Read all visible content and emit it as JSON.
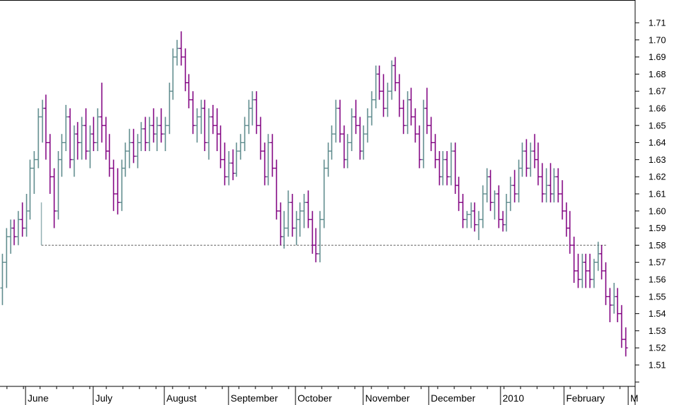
{
  "chart_data": {
    "type": "ohlc",
    "y_axis": {
      "position": "right",
      "ylim": [
        1.5,
        1.716
      ],
      "ticks": [
        "1.51",
        "1.52",
        "1.53",
        "1.54",
        "1.55",
        "1.56",
        "1.57",
        "1.58",
        "1.59",
        "1.60",
        "1.61",
        "1.62",
        "1.63",
        "1.64",
        "1.65",
        "1.66",
        "1.67",
        "1.68",
        "1.69",
        "1.70",
        "1.71"
      ]
    },
    "x_axis": {
      "months": [
        "June",
        "July",
        "August",
        "September",
        "October",
        "November",
        "December",
        "2010",
        "February",
        "M"
      ],
      "bars_per_month": [
        21,
        23,
        21,
        21,
        22,
        21,
        21,
        20,
        20,
        6
      ]
    },
    "colors": {
      "up": "#5d8a8c",
      "down": "#800080",
      "reference_line": "#666666"
    },
    "reference_line": {
      "y": 1.58,
      "style": "dotted",
      "from_month": "June",
      "to_month": "February"
    },
    "bars": [
      [
        1.555,
        1.575,
        1.545,
        1.57
      ],
      [
        1.57,
        1.59,
        1.555,
        1.585
      ],
      [
        1.585,
        1.595,
        1.575,
        1.59
      ],
      [
        1.59,
        1.595,
        1.58,
        1.585
      ],
      [
        1.585,
        1.6,
        1.58,
        1.595
      ],
      [
        1.595,
        1.605,
        1.585,
        1.59
      ],
      [
        1.59,
        1.61,
        1.585,
        1.6
      ],
      [
        1.6,
        1.63,
        1.595,
        1.625
      ],
      [
        1.625,
        1.635,
        1.61,
        1.63
      ],
      [
        1.63,
        1.66,
        1.625,
        1.655
      ],
      [
        1.655,
        1.665,
        1.64,
        1.66
      ],
      [
        1.66,
        1.668,
        1.63,
        1.64
      ],
      [
        1.64,
        1.645,
        1.61,
        1.62
      ],
      [
        1.62,
        1.625,
        1.59,
        1.6
      ],
      [
        1.6,
        1.635,
        1.595,
        1.63
      ],
      [
        1.63,
        1.645,
        1.62,
        1.64
      ],
      [
        1.64,
        1.662,
        1.635,
        1.655
      ],
      [
        1.655,
        1.66,
        1.625,
        1.63
      ],
      [
        1.63,
        1.65,
        1.62,
        1.645
      ],
      [
        1.645,
        1.652,
        1.63,
        1.64
      ],
      [
        1.64,
        1.655,
        1.63,
        1.65
      ],
      [
        1.65,
        1.66,
        1.63,
        1.635
      ],
      [
        1.635,
        1.65,
        1.625,
        1.645
      ],
      [
        1.645,
        1.655,
        1.635,
        1.64
      ],
      [
        1.64,
        1.66,
        1.635,
        1.655
      ],
      [
        1.655,
        1.675,
        1.64,
        1.65
      ],
      [
        1.65,
        1.655,
        1.63,
        1.635
      ],
      [
        1.635,
        1.645,
        1.62,
        1.625
      ],
      [
        1.625,
        1.63,
        1.6,
        1.61
      ],
      [
        1.61,
        1.625,
        1.598,
        1.605
      ],
      [
        1.605,
        1.63,
        1.6,
        1.625
      ],
      [
        1.625,
        1.64,
        1.62,
        1.635
      ],
      [
        1.635,
        1.648,
        1.625,
        1.64
      ],
      [
        1.64,
        1.648,
        1.628,
        1.632
      ],
      [
        1.632,
        1.645,
        1.625,
        1.64
      ],
      [
        1.64,
        1.652,
        1.635,
        1.648
      ],
      [
        1.648,
        1.655,
        1.635,
        1.64
      ],
      [
        1.64,
        1.655,
        1.635,
        1.65
      ],
      [
        1.65,
        1.66,
        1.64,
        1.645
      ],
      [
        1.645,
        1.655,
        1.635,
        1.65
      ],
      [
        1.65,
        1.66,
        1.64,
        1.645
      ],
      [
        1.645,
        1.655,
        1.635,
        1.65
      ],
      [
        1.65,
        1.675,
        1.645,
        1.67
      ],
      [
        1.67,
        1.695,
        1.665,
        1.69
      ],
      [
        1.69,
        1.7,
        1.685,
        1.695
      ],
      [
        1.695,
        1.705,
        1.685,
        1.69
      ],
      [
        1.69,
        1.695,
        1.67,
        1.675
      ],
      [
        1.675,
        1.68,
        1.66,
        1.665
      ],
      [
        1.665,
        1.67,
        1.645,
        1.65
      ],
      [
        1.65,
        1.66,
        1.64,
        1.655
      ],
      [
        1.655,
        1.665,
        1.645,
        1.66
      ],
      [
        1.66,
        1.665,
        1.635,
        1.64
      ],
      [
        1.64,
        1.66,
        1.63,
        1.655
      ],
      [
        1.655,
        1.662,
        1.645,
        1.65
      ],
      [
        1.65,
        1.66,
        1.635,
        1.645
      ],
      [
        1.645,
        1.65,
        1.625,
        1.63
      ],
      [
        1.63,
        1.64,
        1.615,
        1.62
      ],
      [
        1.62,
        1.635,
        1.615,
        1.628
      ],
      [
        1.628,
        1.636,
        1.618,
        1.622
      ],
      [
        1.622,
        1.64,
        1.62,
        1.635
      ],
      [
        1.635,
        1.645,
        1.63,
        1.64
      ],
      [
        1.64,
        1.655,
        1.635,
        1.65
      ],
      [
        1.65,
        1.665,
        1.645,
        1.66
      ],
      [
        1.66,
        1.67,
        1.65,
        1.665
      ],
      [
        1.665,
        1.67,
        1.645,
        1.65
      ],
      [
        1.65,
        1.655,
        1.63,
        1.635
      ],
      [
        1.635,
        1.64,
        1.615,
        1.62
      ],
      [
        1.62,
        1.645,
        1.615,
        1.64
      ],
      [
        1.64,
        1.645,
        1.62,
        1.625
      ],
      [
        1.625,
        1.63,
        1.595,
        1.6
      ],
      [
        1.6,
        1.605,
        1.58,
        1.585
      ],
      [
        1.585,
        1.6,
        1.578,
        1.59
      ],
      [
        1.59,
        1.612,
        1.585,
        1.605
      ],
      [
        1.605,
        1.61,
        1.585,
        1.59
      ],
      [
        1.59,
        1.6,
        1.58,
        1.595
      ],
      [
        1.595,
        1.605,
        1.585,
        1.6
      ],
      [
        1.6,
        1.61,
        1.59,
        1.605
      ],
      [
        1.605,
        1.612,
        1.59,
        1.595
      ],
      [
        1.595,
        1.6,
        1.575,
        1.58
      ],
      [
        1.58,
        1.59,
        1.57,
        1.575
      ],
      [
        1.575,
        1.6,
        1.57,
        1.595
      ],
      [
        1.595,
        1.63,
        1.59,
        1.625
      ],
      [
        1.625,
        1.64,
        1.62,
        1.635
      ],
      [
        1.635,
        1.65,
        1.63,
        1.645
      ],
      [
        1.645,
        1.665,
        1.64,
        1.66
      ],
      [
        1.66,
        1.665,
        1.64,
        1.645
      ],
      [
        1.645,
        1.65,
        1.625,
        1.63
      ],
      [
        1.63,
        1.645,
        1.625,
        1.64
      ],
      [
        1.64,
        1.66,
        1.635,
        1.655
      ],
      [
        1.655,
        1.665,
        1.645,
        1.65
      ],
      [
        1.65,
        1.655,
        1.63,
        1.635
      ],
      [
        1.635,
        1.65,
        1.63,
        1.645
      ],
      [
        1.645,
        1.66,
        1.64,
        1.655
      ],
      [
        1.655,
        1.67,
        1.65,
        1.665
      ],
      [
        1.665,
        1.685,
        1.66,
        1.68
      ],
      [
        1.68,
        1.685,
        1.665,
        1.67
      ],
      [
        1.67,
        1.68,
        1.655,
        1.66
      ],
      [
        1.66,
        1.675,
        1.655,
        1.67
      ],
      [
        1.67,
        1.688,
        1.665,
        1.685
      ],
      [
        1.685,
        1.69,
        1.67,
        1.675
      ],
      [
        1.675,
        1.68,
        1.655,
        1.66
      ],
      [
        1.66,
        1.665,
        1.645,
        1.65
      ],
      [
        1.65,
        1.67,
        1.645,
        1.665
      ],
      [
        1.665,
        1.672,
        1.65,
        1.655
      ],
      [
        1.655,
        1.66,
        1.64,
        1.645
      ],
      [
        1.645,
        1.65,
        1.625,
        1.63
      ],
      [
        1.63,
        1.665,
        1.625,
        1.66
      ],
      [
        1.66,
        1.672,
        1.645,
        1.65
      ],
      [
        1.65,
        1.655,
        1.635,
        1.64
      ],
      [
        1.64,
        1.645,
        1.625,
        1.63
      ],
      [
        1.63,
        1.635,
        1.615,
        1.62
      ],
      [
        1.62,
        1.635,
        1.615,
        1.63
      ],
      [
        1.63,
        1.635,
        1.615,
        1.62
      ],
      [
        1.62,
        1.64,
        1.615,
        1.635
      ],
      [
        1.635,
        1.64,
        1.61,
        1.615
      ],
      [
        1.615,
        1.62,
        1.6,
        1.605
      ],
      [
        1.605,
        1.61,
        1.59,
        1.595
      ],
      [
        1.595,
        1.6,
        1.59,
        1.598
      ],
      [
        1.598,
        1.605,
        1.59,
        1.6
      ],
      [
        1.6,
        1.605,
        1.588,
        1.592
      ],
      [
        1.592,
        1.6,
        1.583,
        1.595
      ],
      [
        1.595,
        1.615,
        1.59,
        1.61
      ],
      [
        1.61,
        1.625,
        1.605,
        1.62
      ],
      [
        1.62,
        1.624,
        1.6,
        1.605
      ],
      [
        1.605,
        1.612,
        1.595,
        1.61
      ],
      [
        1.61,
        1.615,
        1.59,
        1.595
      ],
      [
        1.595,
        1.6,
        1.588,
        1.592
      ],
      [
        1.592,
        1.61,
        1.588,
        1.605
      ],
      [
        1.605,
        1.62,
        1.6,
        1.615
      ],
      [
        1.615,
        1.624,
        1.605,
        1.61
      ],
      [
        1.61,
        1.63,
        1.605,
        1.625
      ],
      [
        1.625,
        1.64,
        1.62,
        1.635
      ],
      [
        1.635,
        1.642,
        1.62,
        1.625
      ],
      [
        1.625,
        1.64,
        1.62,
        1.635
      ],
      [
        1.635,
        1.645,
        1.625,
        1.63
      ],
      [
        1.63,
        1.64,
        1.615,
        1.62
      ],
      [
        1.62,
        1.628,
        1.605,
        1.61
      ],
      [
        1.61,
        1.625,
        1.605,
        1.615
      ],
      [
        1.615,
        1.628,
        1.605,
        1.61
      ],
      [
        1.61,
        1.625,
        1.605,
        1.62
      ],
      [
        1.62,
        1.625,
        1.605,
        1.61
      ],
      [
        1.61,
        1.618,
        1.595,
        1.6
      ],
      [
        1.6,
        1.605,
        1.585,
        1.59
      ],
      [
        1.59,
        1.6,
        1.575,
        1.58
      ],
      [
        1.58,
        1.585,
        1.558,
        1.565
      ],
      [
        1.565,
        1.575,
        1.555,
        1.56
      ],
      [
        1.56,
        1.575,
        1.555,
        1.57
      ],
      [
        1.57,
        1.575,
        1.555,
        1.565
      ],
      [
        1.565,
        1.575,
        1.555,
        1.56
      ],
      [
        1.56,
        1.572,
        1.555,
        1.57
      ],
      [
        1.57,
        1.582,
        1.565,
        1.575
      ],
      [
        1.575,
        1.58,
        1.56,
        1.565
      ],
      [
        1.565,
        1.57,
        1.545,
        1.55
      ],
      [
        1.55,
        1.555,
        1.535,
        1.545
      ],
      [
        1.545,
        1.558,
        1.54,
        1.55
      ],
      [
        1.55,
        1.555,
        1.535,
        1.54
      ],
      [
        1.54,
        1.545,
        1.52,
        1.525
      ],
      [
        1.525,
        1.532,
        1.515,
        1.52
      ]
    ]
  }
}
